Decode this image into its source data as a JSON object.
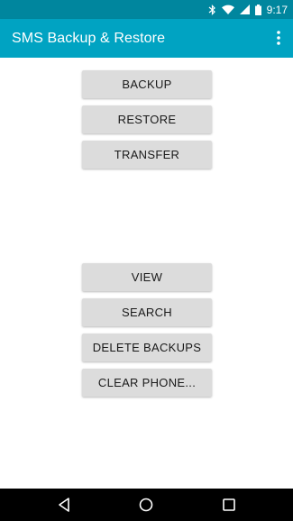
{
  "status_bar": {
    "time": "9:17",
    "icons": [
      "bluetooth-icon",
      "wifi-icon",
      "signal-icon",
      "battery-icon"
    ],
    "background": "#00869e"
  },
  "app_bar": {
    "title": "SMS Backup & Restore",
    "background": "#00a3c2",
    "menu_icon": "overflow-menu-icon"
  },
  "buttons": {
    "backup": "BACKUP",
    "restore": "RESTORE",
    "transfer": "TRANSFER",
    "view": "VIEW",
    "search": "SEARCH",
    "delete_backups": "DELETE BACKUPS",
    "clear_phone": "CLEAR PHONE..."
  },
  "nav_bar": {
    "icons": [
      "back-icon",
      "home-icon",
      "recents-icon"
    ]
  }
}
